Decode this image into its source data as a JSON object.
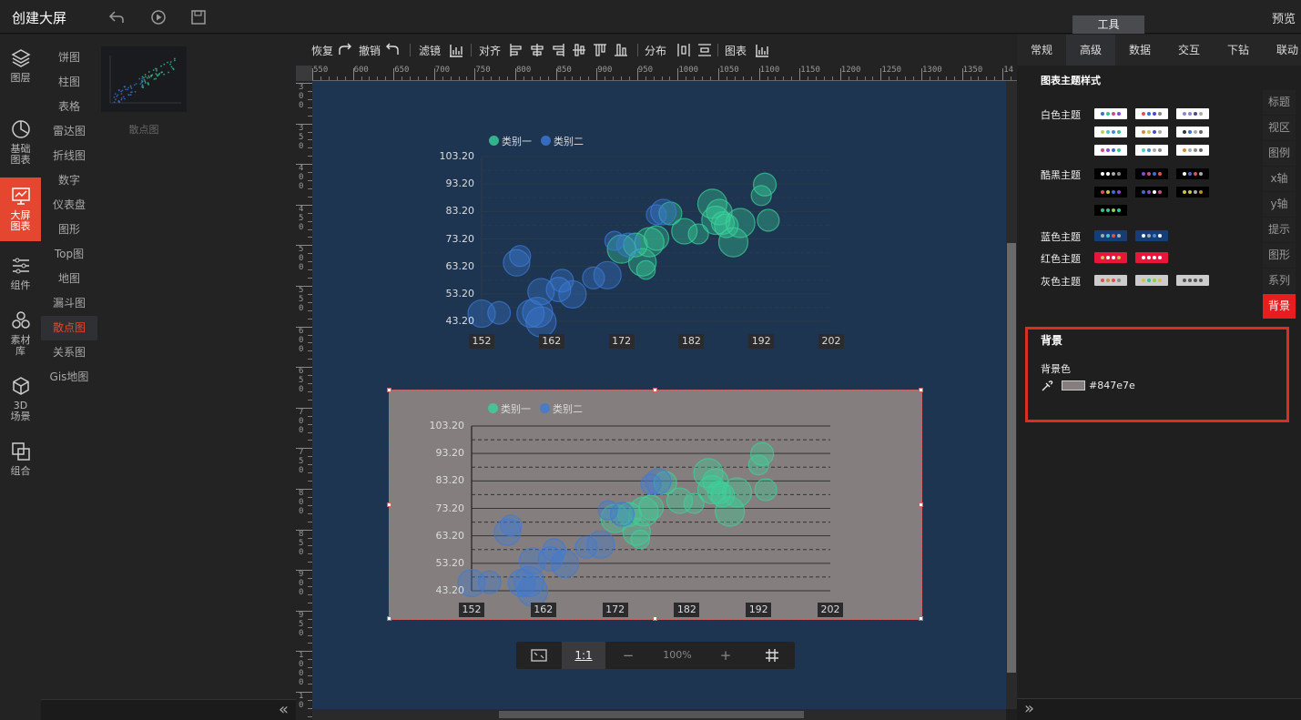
{
  "app": {
    "title": "创建大屏",
    "preview_label": "预览",
    "tools_tab": "工具"
  },
  "sidebar": {
    "items": [
      {
        "label": "图层",
        "icon": "layers-icon"
      },
      {
        "label": "基础\n图表",
        "icon": "pie-clock-icon"
      },
      {
        "label": "大屏\n图表",
        "icon": "screen-chart-icon",
        "active": true
      },
      {
        "label": "组件",
        "icon": "sliders-icon"
      },
      {
        "label": "素材\n库",
        "icon": "circles-icon"
      },
      {
        "label": "3D\n场景",
        "icon": "cube-icon"
      },
      {
        "label": "组合",
        "icon": "combine-icon"
      }
    ]
  },
  "categories": [
    "饼图",
    "柱图",
    "表格",
    "雷达图",
    "折线图",
    "数字",
    "仪表盘",
    "图形",
    "Top图",
    "地图",
    "漏斗图",
    "散点图",
    "关系图",
    "Gis地图"
  ],
  "active_category": "散点图",
  "thumbnail": {
    "label": "散点图"
  },
  "toolbar": {
    "redo": "恢复",
    "undo": "撤销",
    "filter": "滤镜",
    "align": "对齐",
    "distribute": "分布",
    "chart": "图表"
  },
  "ruler": {
    "h": [
      "550",
      "600",
      "650",
      "700",
      "750",
      "800",
      "850",
      "900",
      "950",
      "1000",
      "1050",
      "1100",
      "1150",
      "1200",
      "1250",
      "1300",
      "1350",
      "14"
    ],
    "v": [
      "300",
      "350",
      "400",
      "450",
      "500",
      "550",
      "600",
      "650",
      "700",
      "750",
      "800",
      "850",
      "900",
      "950",
      "1000",
      "10"
    ]
  },
  "chart_data": [
    {
      "type": "scatter",
      "legend": [
        "类别一",
        "类别二"
      ],
      "y_ticks": [
        "103.20",
        "93.20",
        "83.20",
        "73.20",
        "63.20",
        "53.20",
        "43.20"
      ],
      "x_ticks": [
        "152",
        "162",
        "172",
        "182",
        "192",
        "202"
      ],
      "xlim": [
        152,
        202
      ],
      "ylim": [
        43.2,
        103.2
      ],
      "series": [
        {
          "name": "类别一",
          "points": [
            [
              172,
              69.5
            ],
            [
              174,
              71
            ],
            [
              175,
              64.7
            ],
            [
              175.5,
              61.9
            ],
            [
              176,
              72
            ],
            [
              177,
              73.5
            ],
            [
              179,
              82.5
            ],
            [
              181,
              76
            ],
            [
              183,
              75
            ],
            [
              185,
              86
            ],
            [
              185.5,
              80
            ],
            [
              186,
              83
            ],
            [
              186.5,
              79
            ],
            [
              187,
              78
            ],
            [
              188,
              72
            ],
            [
              189,
              79
            ],
            [
              192,
              89
            ],
            [
              192.5,
              93
            ],
            [
              193,
              80
            ]
          ]
        },
        {
          "name": "类别二",
          "points": [
            [
              152,
              46
            ],
            [
              154.5,
              46.3
            ],
            [
              157,
              64.5
            ],
            [
              157.5,
              67
            ],
            [
              159,
              46
            ],
            [
              160,
              46.5
            ],
            [
              160.5,
              43
            ],
            [
              160.5,
              54
            ],
            [
              163,
              54.8
            ],
            [
              163.5,
              58
            ],
            [
              165,
              53
            ],
            [
              168,
              59
            ],
            [
              170,
              60
            ],
            [
              171,
              72.5
            ],
            [
              173,
              71
            ],
            [
              177,
              82
            ],
            [
              178,
              83
            ]
          ]
        }
      ]
    },
    {
      "type": "scatter",
      "legend": [
        "类别一",
        "类别二"
      ],
      "y_ticks": [
        "103.20",
        "93.20",
        "83.20",
        "73.20",
        "63.20",
        "53.20",
        "43.20"
      ],
      "x_ticks": [
        "152",
        "162",
        "172",
        "182",
        "192",
        "202"
      ],
      "xlim": [
        152,
        202
      ],
      "ylim": [
        43.2,
        103.2
      ],
      "background": "#847e7e"
    }
  ],
  "zoom": {
    "fit_label": "1:1",
    "zoom_value": "100%",
    "minus": "−",
    "plus": "+"
  },
  "right_panel": {
    "tabs": [
      "常规",
      "高级",
      "数据",
      "交互",
      "下钻",
      "联动"
    ],
    "active_tab": "高级",
    "section_title": "图表主题样式",
    "themes": [
      {
        "label": "白色主题"
      },
      {
        "label": "酷黑主题"
      },
      {
        "label": "蓝色主题"
      },
      {
        "label": "红色主题"
      },
      {
        "label": "灰色主题"
      }
    ],
    "vtabs": [
      "标题",
      "视区",
      "图例",
      "x轴",
      "y轴",
      "提示",
      "图形",
      "系列",
      "背景"
    ],
    "bg": {
      "title": "背景",
      "color_label": "背景色",
      "color_value": "#847e7e"
    }
  },
  "colors": {
    "accent": "#e5462f",
    "canvas": "#1d3550",
    "series1": "#3ad39a",
    "series2": "#3c7bd8",
    "bg2": "#847e7e"
  }
}
